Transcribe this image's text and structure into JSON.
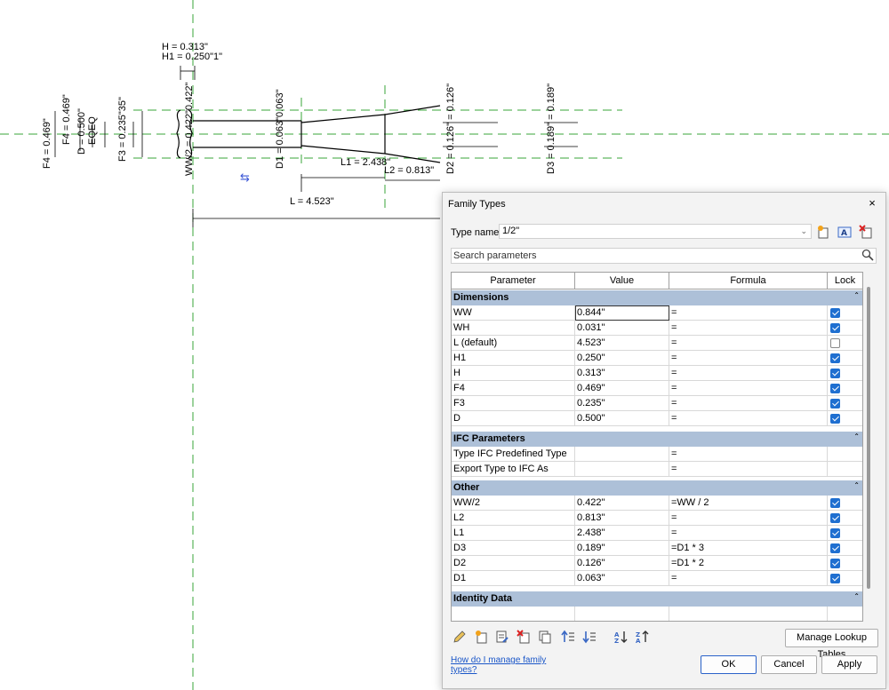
{
  "drawing": {
    "labels": {
      "h": "H = 0.313\"",
      "h1": "H1 = 0.250\"1\"",
      "f4_left": "F4 = 0.469\"",
      "f4_b": "F4 = 0.469\"",
      "d": "D = 0.500\"",
      "eqeq": "EQEQ",
      "f3": "F3 = 0.235\"35\"",
      "ww2": "WW/2 = 0.422\"0.422\"",
      "d1": "D1 = 0.063\"0.063\"",
      "l1": "L1 = 2.438\"",
      "l2": "L2 = 0.813\"",
      "l": "L = 4.523\"",
      "d2": "D2 = 0.126\" = 0.126\"",
      "d3": "D3 = 0.189\" = 0.189\""
    }
  },
  "dialog": {
    "title": "Family Types",
    "close_glyph": "×",
    "type_name_label": "Type name:",
    "type_name_value": "1/2\"",
    "search_placeholder": "Search parameters",
    "columns": [
      "Parameter",
      "Value",
      "Formula",
      "Lock"
    ],
    "sections": [
      {
        "name": "Dimensions",
        "rows": [
          {
            "parameter": "WW",
            "value": "0.844\"",
            "formula": "=",
            "lock": true
          },
          {
            "parameter": "WH",
            "value": "0.031\"",
            "formula": "=",
            "lock": true
          },
          {
            "parameter": "L (default)",
            "value": "4.523\"",
            "formula": "=",
            "lock": false
          },
          {
            "parameter": "H1",
            "value": "0.250\"",
            "formula": "=",
            "lock": true
          },
          {
            "parameter": "H",
            "value": "0.313\"",
            "formula": "=",
            "lock": true
          },
          {
            "parameter": "F4",
            "value": "0.469\"",
            "formula": "=",
            "lock": true
          },
          {
            "parameter": "F3",
            "value": "0.235\"",
            "formula": "=",
            "lock": true
          },
          {
            "parameter": "D",
            "value": "0.500\"",
            "formula": "=",
            "lock": true
          }
        ]
      },
      {
        "name": "IFC Parameters",
        "rows": [
          {
            "parameter": "Type IFC Predefined Type",
            "value": "",
            "formula": "=",
            "lock": null
          },
          {
            "parameter": "Export Type to IFC As",
            "value": "",
            "formula": "=",
            "lock": null
          }
        ]
      },
      {
        "name": "Other",
        "rows": [
          {
            "parameter": "WW/2",
            "value": "0.422\"",
            "formula": "=WW / 2",
            "lock": true
          },
          {
            "parameter": "L2",
            "value": "0.813\"",
            "formula": "=",
            "lock": true
          },
          {
            "parameter": "L1",
            "value": "2.438\"",
            "formula": "=",
            "lock": true
          },
          {
            "parameter": "D3",
            "value": "0.189\"",
            "formula": "=D1 * 3",
            "lock": true
          },
          {
            "parameter": "D2",
            "value": "0.126\"",
            "formula": "=D1 * 2",
            "lock": true
          },
          {
            "parameter": "D1",
            "value": "0.063\"",
            "formula": "=",
            "lock": true
          }
        ]
      },
      {
        "name": "Identity Data",
        "rows": []
      }
    ],
    "manage_lookup_label": "Manage Lookup Tables",
    "help_link": "How do I manage family types?",
    "ok_label": "OK",
    "cancel_label": "Cancel",
    "apply_label": "Apply"
  },
  "colors": {
    "reference_line": "#3aa63a",
    "section_header": "#adc0d8",
    "lock_checked": "#1f6fd0",
    "link": "#1a56c8"
  }
}
